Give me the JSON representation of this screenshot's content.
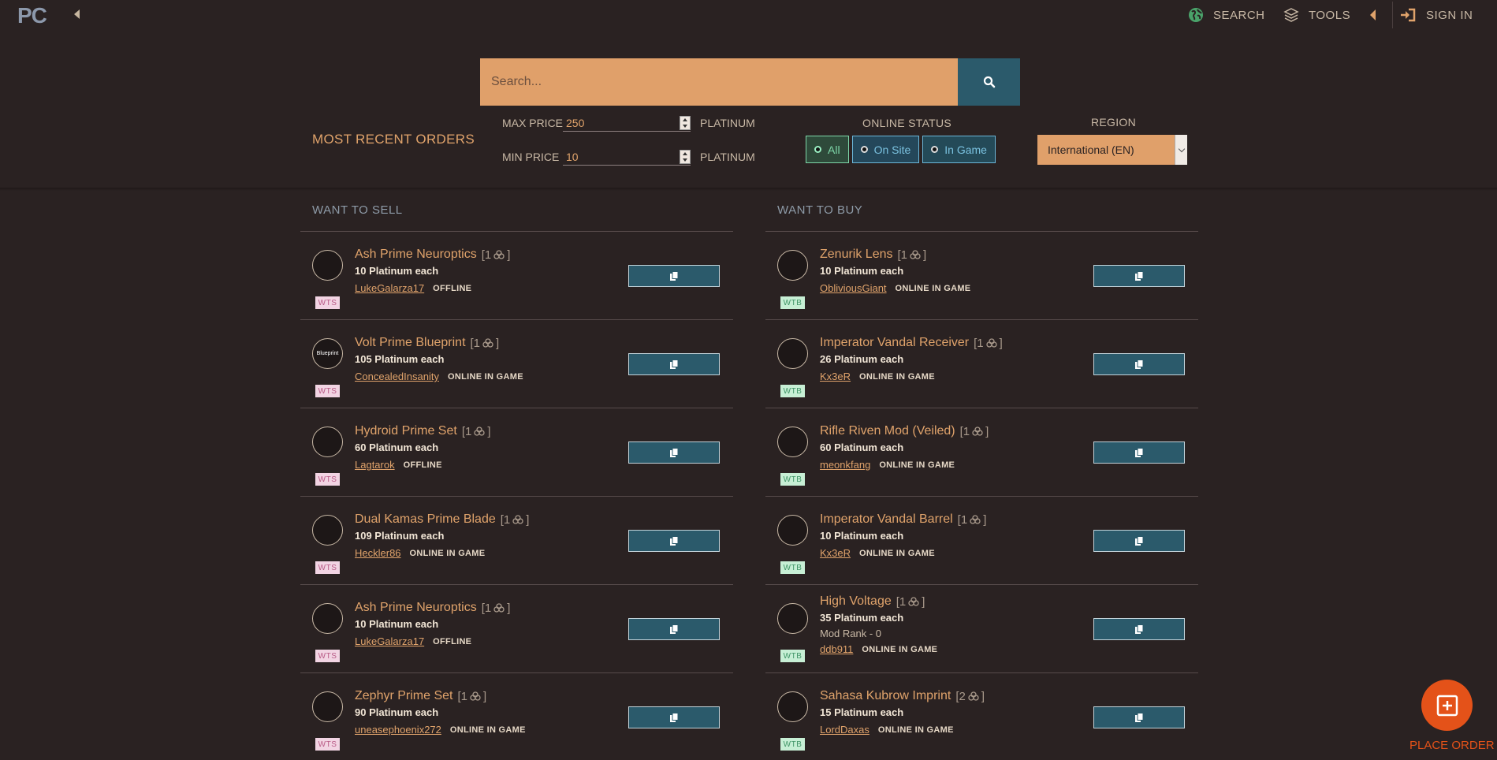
{
  "app": {
    "logo": "PC"
  },
  "nav": {
    "search_label": "SEARCH",
    "tools_label": "TOOLS",
    "signin_label": "SIGN IN"
  },
  "search": {
    "placeholder": "Search..."
  },
  "filters": {
    "title": "MOST RECENT ORDERS",
    "max_price_label": "MAX PRICE",
    "max_price_value": "250",
    "min_price_label": "MIN PRICE",
    "min_price_value": "10",
    "unit": "PLATINUM",
    "online_status_title": "ONLINE STATUS",
    "status_options": [
      "All",
      "On Site",
      "In Game"
    ],
    "selected_status": "All",
    "region_title": "REGION",
    "region_value": "International (EN)"
  },
  "sell": {
    "title": "WANT TO SELL",
    "orders": [
      {
        "item": "Ash Prime Neuroptics",
        "qty": "[1",
        "qty_end": "]",
        "price": "10 Platinum each",
        "user": "LukeGalarza17",
        "status": "OFFLINE",
        "badge": "WTS"
      },
      {
        "item": "Volt Prime Blueprint",
        "qty": "[1",
        "qty_end": "]",
        "price": "105 Platinum each",
        "user": "ConcealedInsanity",
        "status": "ONLINE IN GAME",
        "badge": "WTS",
        "avatar_text": "Blueprint"
      },
      {
        "item": "Hydroid Prime Set",
        "qty": "[1",
        "qty_end": "]",
        "price": "60 Platinum each",
        "user": "Lagtarok",
        "status": "OFFLINE",
        "badge": "WTS"
      },
      {
        "item": "Dual Kamas Prime Blade",
        "qty": "[1",
        "qty_end": "]",
        "price": "109 Platinum each",
        "user": "Heckler86",
        "status": "ONLINE IN GAME",
        "badge": "WTS"
      },
      {
        "item": "Ash Prime Neuroptics",
        "qty": "[1",
        "qty_end": "]",
        "price": "10 Platinum each",
        "user": "LukeGalarza17",
        "status": "OFFLINE",
        "badge": "WTS"
      },
      {
        "item": "Zephyr Prime Set",
        "qty": "[1",
        "qty_end": "]",
        "price": "90 Platinum each",
        "user": "uneasephoenix272",
        "status": "ONLINE IN GAME",
        "badge": "WTS"
      }
    ]
  },
  "buy": {
    "title": "WANT TO BUY",
    "orders": [
      {
        "item": "Zenurik Lens",
        "qty": "[1",
        "qty_end": "]",
        "price": "10 Platinum each",
        "user": "ObliviousGiant",
        "status": "ONLINE IN GAME",
        "badge": "WTB"
      },
      {
        "item": "Imperator Vandal Receiver",
        "qty": "[1",
        "qty_end": "]",
        "price": "26 Platinum each",
        "user": "Kx3eR",
        "status": "ONLINE IN GAME",
        "badge": "WTB"
      },
      {
        "item": "Rifle Riven Mod (Veiled)",
        "qty": "[1",
        "qty_end": "]",
        "price": "60 Platinum each",
        "user": "meonkfang",
        "status": "ONLINE IN GAME",
        "badge": "WTB"
      },
      {
        "item": "Imperator Vandal Barrel",
        "qty": "[1",
        "qty_end": "]",
        "price": "10 Platinum each",
        "user": "Kx3eR",
        "status": "ONLINE IN GAME",
        "badge": "WTB"
      },
      {
        "item": "High Voltage",
        "qty": "[1",
        "qty_end": "]",
        "price": "35 Platinum each",
        "rank": "Mod Rank - 0",
        "user": "ddb911",
        "status": "ONLINE IN GAME",
        "badge": "WTB"
      },
      {
        "item": "Sahasa Kubrow Imprint",
        "qty": "[2",
        "qty_end": "]",
        "price": "15 Platinum each",
        "user": "LordDaxas",
        "status": "ONLINE IN GAME",
        "badge": "WTB"
      }
    ]
  },
  "fab": {
    "label": "PLACE ORDER"
  },
  "colors": {
    "background": "#2a2222",
    "accent": "#e0a36b",
    "primary_button": "#2b5a6b",
    "place_order": "#e45219"
  }
}
